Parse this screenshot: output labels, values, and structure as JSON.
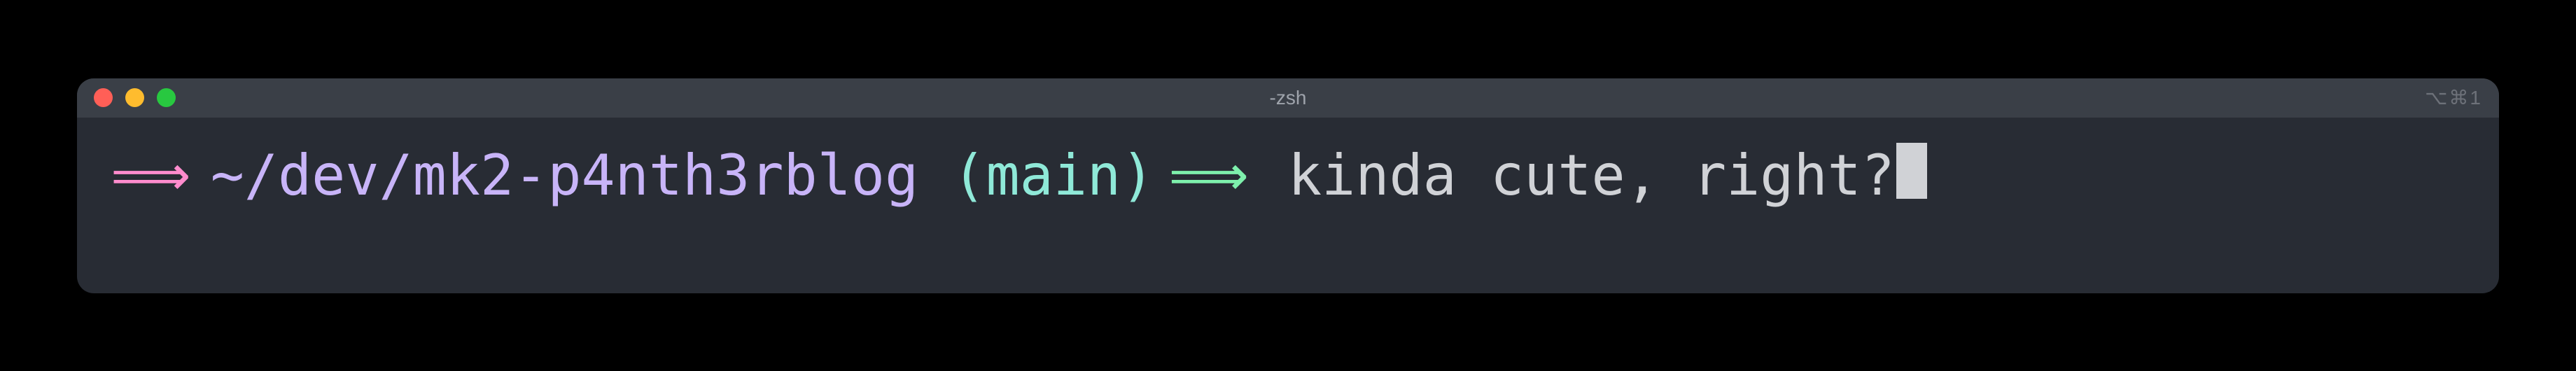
{
  "window": {
    "title": "-zsh",
    "titlebar_right": "⌥⌘1"
  },
  "prompt": {
    "arrow1": "⟹",
    "path": "~/dev/mk2-p4nth3rblog",
    "branch_open": "(",
    "branch": "main",
    "branch_close": ")",
    "arrow2": "⟹",
    "command": "kinda cute, right?"
  }
}
